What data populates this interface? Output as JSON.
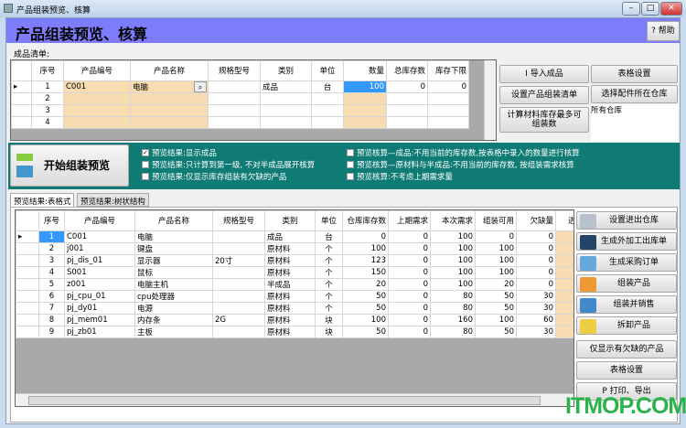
{
  "window": {
    "title": "产品组装预览、核算",
    "controls": [
      "minimize",
      "maximize",
      "close"
    ]
  },
  "header": {
    "title": "产品组装预览、核算",
    "help_label": "? 帮助"
  },
  "product_list": {
    "label": "成品清单:",
    "columns": [
      "序号",
      "产品编号",
      "产品名称",
      "规格型号",
      "类别",
      "单位",
      "数量",
      "总库存数",
      "库存下限"
    ],
    "rows": [
      [
        "1",
        "C001",
        "电脑",
        "",
        "成品",
        "台",
        "100",
        "0",
        "0"
      ],
      [
        "2",
        "",
        "",
        "",
        "",
        "",
        "",
        "",
        ""
      ],
      [
        "3",
        "",
        "",
        "",
        "",
        "",
        "",
        "",
        ""
      ],
      [
        "4",
        "",
        "",
        "",
        "",
        "",
        "",
        "",
        ""
      ]
    ]
  },
  "top_buttons": {
    "import": "I 导入成品",
    "table_settings": "表格设置",
    "set_bom": "设置产品组装清单",
    "select_warehouse": "选择配件所在仓库",
    "calc_max": "计算材料库存最多可组装数",
    "warehouse_value": "所有仓库"
  },
  "preview_panel": {
    "start_label": "开始组装预览",
    "options": [
      {
        "label": "预览结果:显示成品",
        "checked": true
      },
      {
        "label": "预览结果:只计算到第一级, 不对半成品展开核算",
        "checked": false
      },
      {
        "label": "预览结果:仅显示库存组装有欠缺的产品",
        "checked": false
      },
      {
        "label": "预览核算—成品:不用当前的库存数,按表格中录入的数量进行核算",
        "checked": false
      },
      {
        "label": "预览核算—原材料与半成品:不用当前的库存数, 按组装需求核算",
        "checked": false
      },
      {
        "label": "预览核算:不考虑上期需求量",
        "checked": false
      }
    ]
  },
  "tabs": [
    {
      "label": "预览结果:表格式",
      "active": true
    },
    {
      "label": "预览结果:树状结构",
      "active": false
    }
  ],
  "result_grid": {
    "columns": [
      "序号",
      "产品编号",
      "产品名称",
      "规格型号",
      "类别",
      "单位",
      "仓库库存数",
      "上期需求",
      "本次需求",
      "组装可用",
      "欠缺量",
      "进出库名"
    ],
    "rows": [
      [
        "1",
        "C001",
        "电脑",
        "",
        "成品",
        "台",
        "0",
        "0",
        "100",
        "0",
        "0"
      ],
      [
        "2",
        "j001",
        "键盘",
        "",
        "原材料",
        "个",
        "100",
        "0",
        "100",
        "100",
        "0"
      ],
      [
        "3",
        "pj_dis_01",
        "显示器",
        "20寸",
        "原材料",
        "个",
        "123",
        "0",
        "100",
        "100",
        "0"
      ],
      [
        "4",
        "S001",
        "鼠标",
        "",
        "原材料",
        "个",
        "150",
        "0",
        "100",
        "100",
        "0"
      ],
      [
        "5",
        "z001",
        "电脑主机",
        "",
        "半成品",
        "个",
        "20",
        "0",
        "100",
        "20",
        "0"
      ],
      [
        "6",
        "pj_cpu_01",
        "cpu处理器",
        "",
        "原材料",
        "个",
        "50",
        "0",
        "80",
        "50",
        "30"
      ],
      [
        "7",
        "pj_dy01",
        "电源",
        "",
        "原材料",
        "个",
        "50",
        "0",
        "80",
        "50",
        "30"
      ],
      [
        "8",
        "pj_mem01",
        "内存条",
        "2G",
        "原材料",
        "块",
        "100",
        "0",
        "160",
        "100",
        "60"
      ],
      [
        "9",
        "pj_zb01",
        "主板",
        "",
        "原材料",
        "块",
        "50",
        "0",
        "80",
        "50",
        "30"
      ]
    ]
  },
  "side_buttons": [
    {
      "label": "设置进出仓库",
      "icon": "database-icon"
    },
    {
      "label": "生成外加工出库单",
      "icon": "book-icon"
    },
    {
      "label": "生成采购订单",
      "icon": "calendar-icon"
    },
    {
      "label": "组装产品",
      "icon": "boxes-icon"
    },
    {
      "label": "组装并销售",
      "icon": "truck-icon"
    },
    {
      "label": "拆卸产品",
      "icon": "puzzle-icon"
    },
    {
      "label": "仅显示有欠缺的产品"
    },
    {
      "label": "表格设置"
    },
    {
      "label": "P 打印、导出"
    }
  ],
  "watermark": "ITMOP.COM",
  "colors": {
    "header": "#7d7dfb",
    "panel": "#0f7b74",
    "editable": "#f6dcb0",
    "selected": "#3399ff"
  }
}
